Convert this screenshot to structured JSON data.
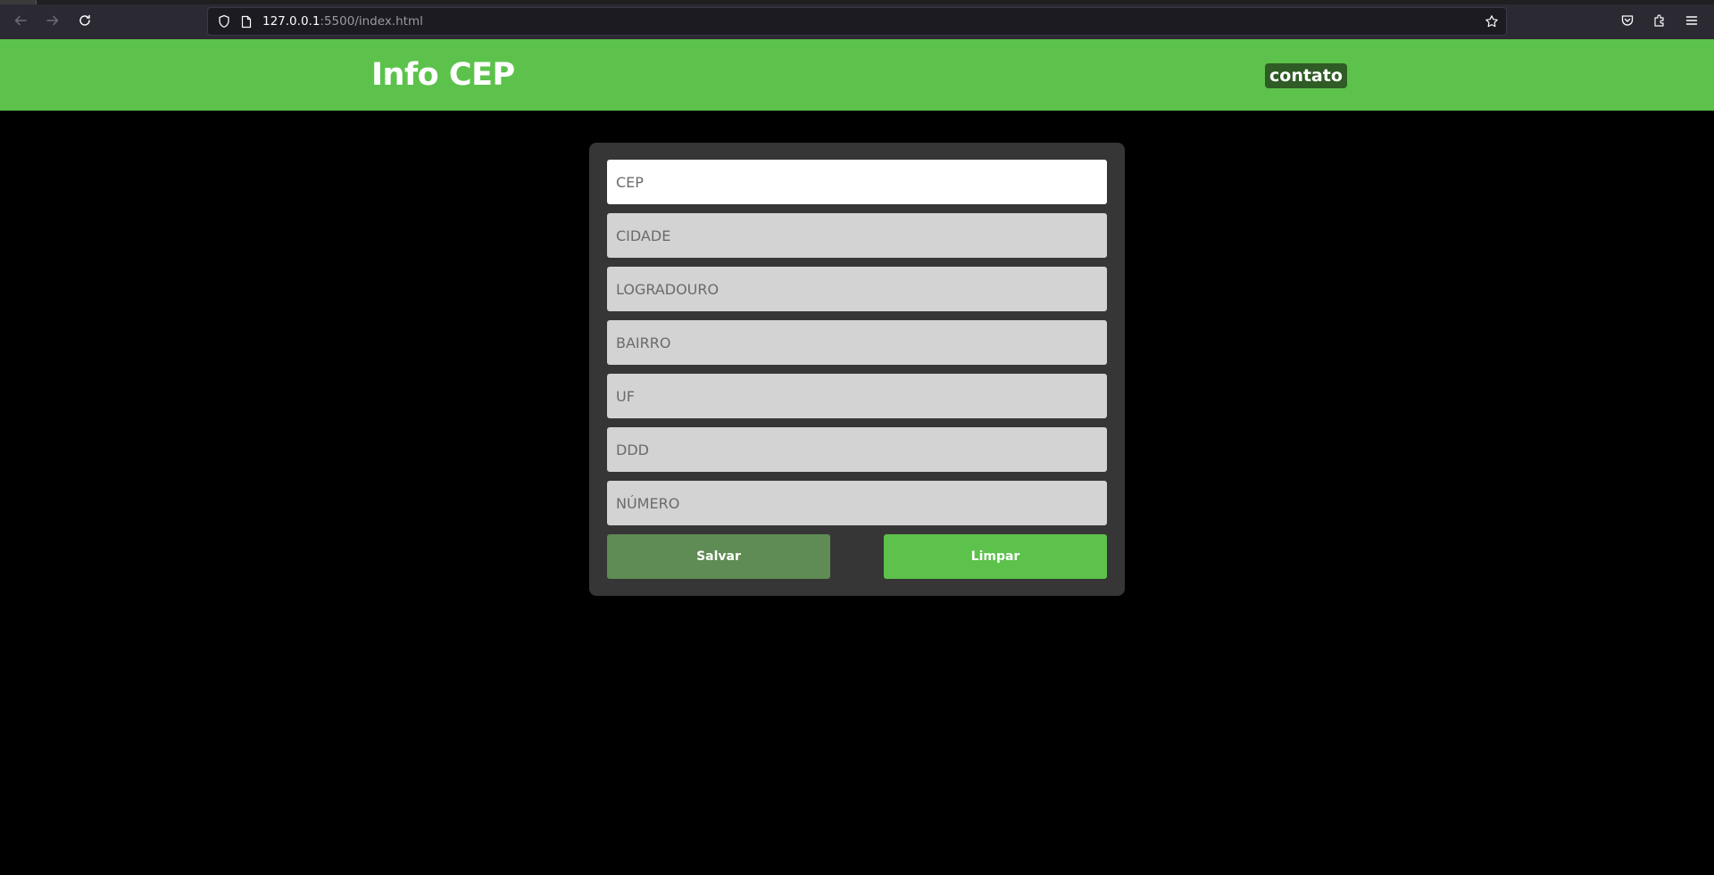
{
  "browser": {
    "url_host": "127.0.0.1",
    "url_rest": ":5500/index.html",
    "icons": {
      "back": "arrow-left-icon",
      "forward": "arrow-right-icon",
      "reload": "reload-icon",
      "shield": "shield-icon",
      "page": "page-icon",
      "bookmark": "star-icon",
      "pocket": "pocket-icon",
      "extensions": "puzzle-icon",
      "menu": "hamburger-menu-icon"
    }
  },
  "header": {
    "title": "Info CEP",
    "contact_label": "contato",
    "background": "#5cc24b",
    "contact_background": "#2f5b25"
  },
  "form": {
    "fields": [
      {
        "placeholder": "CEP",
        "value": ""
      },
      {
        "placeholder": "CIDADE",
        "value": ""
      },
      {
        "placeholder": "LOGRADOURO",
        "value": ""
      },
      {
        "placeholder": "BAIRRO",
        "value": ""
      },
      {
        "placeholder": "UF",
        "value": ""
      },
      {
        "placeholder": "DDD",
        "value": ""
      },
      {
        "placeholder": "NÚMERO",
        "value": ""
      }
    ],
    "save_label": "Salvar",
    "clear_label": "Limpar",
    "save_color": "#5e8c54",
    "clear_color": "#5cc24b"
  }
}
